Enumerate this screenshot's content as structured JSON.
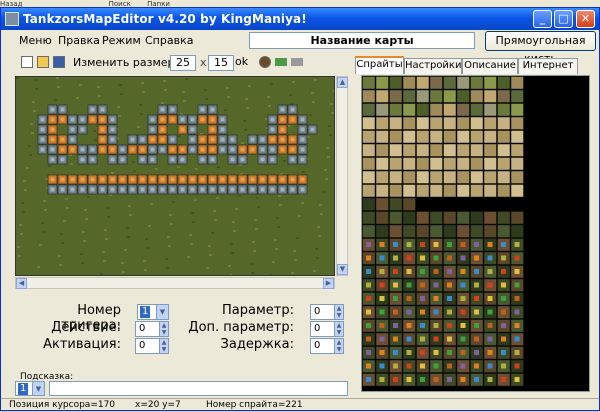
{
  "desktop_taskbar": {
    "items": [
      "Назад",
      "Поиск",
      "Папки"
    ]
  },
  "window": {
    "title": "TankzorsMapEditor v4.20 by KingManiya!",
    "controls": [
      "_",
      "□",
      "✕"
    ]
  },
  "menu": {
    "items": [
      "Меню",
      "Правка",
      "Режим",
      "Справка"
    ]
  },
  "map_name": "Название карты",
  "rect_brush_label": "Прямоугольная кисть",
  "toolbar": {
    "resize_label": "Изменить размер",
    "width": "25",
    "x_sep": "x",
    "height": "15",
    "ok_label": "ok"
  },
  "tabs": [
    "Спрайты",
    "Настройки",
    "Описание",
    "Интернет"
  ],
  "active_tab": "Спрайты",
  "trigger_form": {
    "trigger_number_label": "Номер тригера:",
    "trigger_number_value": "1",
    "action_label": "Действие:",
    "action_value": "0",
    "activation_label": "Активация:",
    "activation_value": "0",
    "param_label": "Параметр:",
    "param_value": "0",
    "extra_param_label": "Доп. параметр:",
    "extra_param_value": "0",
    "delay_label": "Задержка:",
    "delay_value": "0"
  },
  "hint": {
    "label": "Подсказка:",
    "select_value": "1",
    "text": ""
  },
  "status": {
    "cursor_position": "Позиция курсора=170",
    "coords": "x=20 y=7",
    "sprite_number": "Номер спрайта=221"
  },
  "colors": {
    "titlebar": "#0a55e6",
    "grass": "#5a6a2c",
    "sprite_bg": "#000000",
    "accent_tab": "#e68b2c"
  }
}
